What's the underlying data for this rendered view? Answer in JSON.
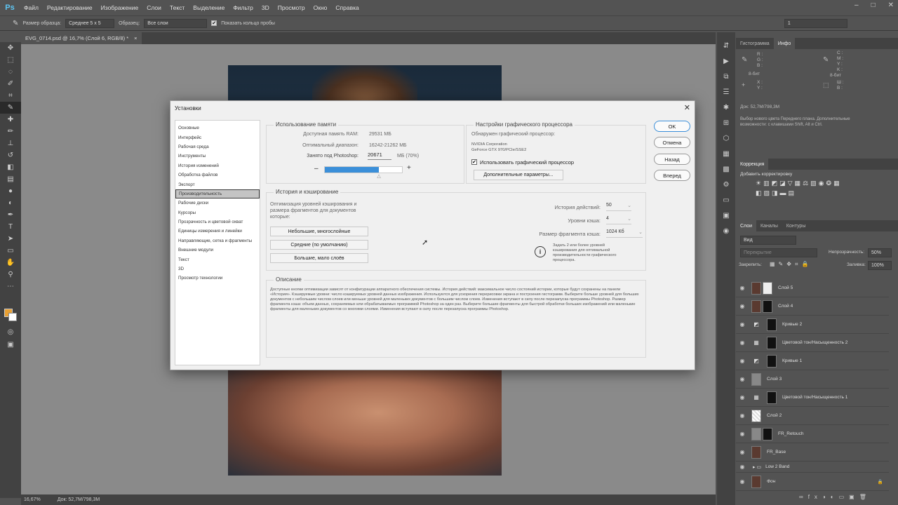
{
  "menubar": {
    "logo": "Ps",
    "items": [
      "Файл",
      "Редактирование",
      "Изображение",
      "Слои",
      "Текст",
      "Выделение",
      "Фильтр",
      "3D",
      "Просмотр",
      "Окно",
      "Справка"
    ],
    "minimize": "–",
    "maximize": "□",
    "close": "✕"
  },
  "options": {
    "sample_size_label": "Размер образца:",
    "sample_size_value": "Среднее 5 x 5",
    "sample_label": "Образец:",
    "sample_value": "Все слои",
    "ring_label": "Показать кольцо пробы",
    "zoom_field": "1"
  },
  "document": {
    "tab_title": "EVG_0714.psd @ 16,7% (Слой 6, RGB/8) *",
    "tab_close": "×"
  },
  "statusbar": {
    "zoom": "16,67%",
    "doc": "Док: 52,7M/798,3M"
  },
  "dialog": {
    "title": "Установки",
    "close": "✕",
    "nav": [
      "Основные",
      "Интерфейс",
      "Рабочая среда",
      "Инструменты",
      "История изменений",
      "Обработка файлов",
      "Экспорт",
      "Производительность",
      "Рабочие диски",
      "Курсоры",
      "Прозрачность и цветовой охват",
      "Единицы измерения и линейки",
      "Направляющие, сетка и фрагменты",
      "Внешние модули",
      "Текст",
      "3D",
      "Просмотр технологии"
    ],
    "nav_selected": 7,
    "memory": {
      "title": "Использование памяти",
      "ram_label": "Доступная память RAM:",
      "ram_value": "29531 МБ",
      "range_label": "Оптимальный диапазон:",
      "range_value": "16242-21262 МБ",
      "ps_label": "Занято под Photoshop:",
      "ps_value": "20671",
      "ps_unit": "МБ (70%)",
      "minus": "–",
      "plus": "+",
      "fill_fraction": 0.7
    },
    "gpu": {
      "title": "Настройки графического процессора",
      "detected_label": "Обнаружен графический процессор:",
      "vendor": "NVIDIA Corporation",
      "model": "GeForce GTX 970/PCIe/SSE2",
      "use_label": "Использовать графический процессор",
      "use_checked": "✔",
      "advanced": "Дополнительные параметры..."
    },
    "history": {
      "title": "История и кэширование",
      "optimize_text": "Оптимизация уровней кэширования и размера фрагментов для документов которые:",
      "btn1": "Небольшие, многослойные",
      "btn2": "Средние (по умолчанию)",
      "btn3": "Большие, мало слоёв",
      "states_label": "История действий:",
      "states_value": "50",
      "levels_label": "Уровни кэша:",
      "levels_value": "4",
      "tile_label": "Размер фрагмента кэша:",
      "tile_value": "1024 Кб",
      "info_icon": "i",
      "info_text": "Задать 2 или более уровней кэширования для оптимальной производительности графического процессора."
    },
    "description": {
      "title": "Описание",
      "text": "Доступные кнопки оптимизации зависят от конфигурации аппаратного обеспечения системы. История действий: максимальное число состояний истории, которые будут сохранены на панели «История». Кэшируемые уровни: число кэшируемых уровней данных изображения. Используются для ускорения перерисовки экрана и построения гистограмм. Выберите больше уровней для больших документов с небольшим числом слоев или меньше уровней для маленьких документов с большим числом слоев. Изменения вступают в силу после перезапуска программы Photoshop. Размер фрагмента кэша: объем данных, сохраняемых или обрабатываемых программой Photoshop за один раз. Выберите большие фрагменты для быстрой обработки больших изображений или маленькие фрагменты для маленьких документов со многими слоями. Изменения вступают в силу после перезапуска программы Photoshop."
    },
    "buttons": {
      "ok": "OK",
      "cancel": "Отмена",
      "back": "Назад",
      "next": "Вперед"
    }
  },
  "panels": {
    "top_tabs": [
      "Гистограмма",
      "Инфо"
    ],
    "info": {
      "r": "R :",
      "g": "G :",
      "b": "B :",
      "bit1": "8-бит",
      "x": "X :",
      "y": "Y :",
      "c": "C :",
      "m": "M :",
      "yk": "Y :",
      "k": "K :",
      "bit2": "8-бит",
      "w": "Ш :",
      "h": "В :",
      "doc": "Док: 52,7M/798,3M",
      "hint": "Выбор нового цвета Переднего плана. Дополнительные возможности: с клавишами Shift, Alt и Ctrl."
    },
    "corrections": {
      "tab": "Коррекция",
      "add": "Добавить корректировку"
    },
    "layers_tabs": [
      "Слои",
      "Каналы",
      "Контуры"
    ],
    "layers": {
      "search": "Вид",
      "blend": "Перекрытие",
      "opacity_label": "Непрозрачность:",
      "opacity": "50%",
      "lock_label": "Закрепить:",
      "fill_label": "Заливка:",
      "fill": "100%",
      "items": [
        "Слой 5",
        "Слой 4",
        "Кривые 2",
        "Цветовой тон/Насыщенность 2",
        "Кривые 1",
        "Слой 3",
        "Цветовой тон/Насыщенность 1",
        "Слой 2",
        "FR_Retouch",
        "FR_Base",
        "Low 2 Band",
        "Фон"
      ]
    }
  },
  "colors": {
    "foreground": "#e8a033",
    "background": "#ffffff",
    "accent": "#3b8fd9"
  }
}
